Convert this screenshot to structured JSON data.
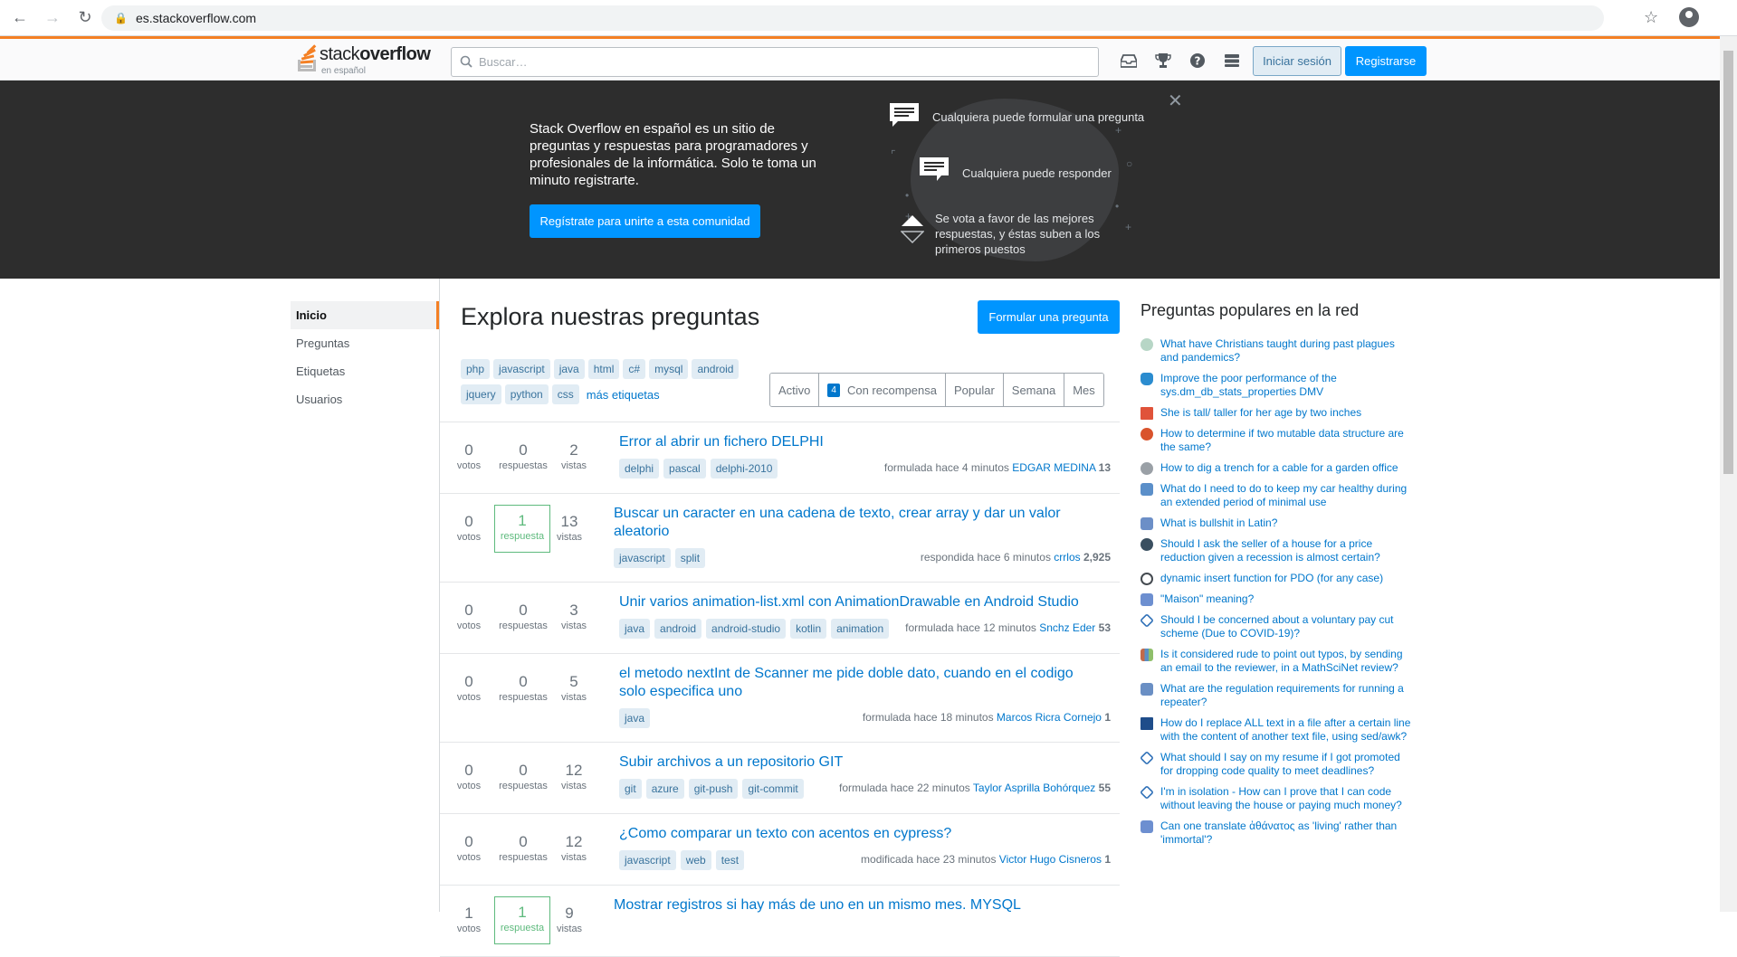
{
  "browser": {
    "url": "es.stackoverflow.com"
  },
  "topbar": {
    "logo_text_a": "stack",
    "logo_text_b": "overflow",
    "logo_sub": "en español",
    "search_placeholder": "Buscar…",
    "login_label": "Iniciar sesión",
    "signup_label": "Registrarse"
  },
  "hero": {
    "text": "Stack Overflow en español es un sitio de preguntas y respuestas para programadores y profesionales de la informática. Solo te toma un minuto registrarte.",
    "button": "Regístrate para unirte a esta comunidad",
    "features": [
      "Cualquiera puede formular una pregunta",
      "Cualquiera puede responder",
      "Se vota a favor de las mejores respuestas, y éstas suben a los primeros puestos"
    ]
  },
  "leftnav": {
    "items": [
      "Inicio",
      "Preguntas",
      "Etiquetas",
      "Usuarios"
    ]
  },
  "main": {
    "title": "Explora nuestras preguntas",
    "ask_button": "Formular una pregunta",
    "tags": [
      "php",
      "javascript",
      "java",
      "html",
      "c#",
      "mysql",
      "android",
      "jquery",
      "python",
      "css"
    ],
    "more_tags": "más etiquetas",
    "filters": {
      "active": "Activo",
      "bounty_count": "4",
      "bounty": "Con recompensa",
      "popular": "Popular",
      "week": "Semana",
      "month": "Mes"
    }
  },
  "questions": [
    {
      "votes": "0",
      "votes_label": "votos",
      "answers": "0",
      "answers_label": "respuestas",
      "views": "2",
      "views_label": "vistas",
      "title": "Error al abrir un fichero DELPHI",
      "tags": [
        "delphi",
        "pascal",
        "delphi-2010"
      ],
      "meta": "formulada hace 4 minutos",
      "user": "EDGAR MEDINA",
      "rep": "13"
    },
    {
      "votes": "0",
      "votes_label": "votos",
      "answers": "1",
      "answers_label": "respuesta",
      "views": "13",
      "views_label": "vistas",
      "title": "Buscar un caracter en una cadena de texto, crear array y dar un valor aleatorio",
      "tags": [
        "javascript",
        "split"
      ],
      "meta": "respondida hace 6 minutos",
      "user": "crrlos",
      "rep": "2,925"
    },
    {
      "votes": "0",
      "votes_label": "votos",
      "answers": "0",
      "answers_label": "respuestas",
      "views": "3",
      "views_label": "vistas",
      "title": "Unir varios animation-list.xml con AnimationDrawable en Android Studio",
      "tags": [
        "java",
        "android",
        "android-studio",
        "kotlin",
        "animation"
      ],
      "meta": "formulada hace 12 minutos",
      "user": "Snchz Eder",
      "rep": "53"
    },
    {
      "votes": "0",
      "votes_label": "votos",
      "answers": "0",
      "answers_label": "respuestas",
      "views": "5",
      "views_label": "vistas",
      "title": "el metodo nextInt de Scanner me pide doble dato, cuando en el codigo solo especifica uno",
      "tags": [
        "java"
      ],
      "meta": "formulada hace 18 minutos",
      "user": "Marcos Ricra Cornejo",
      "rep": "1"
    },
    {
      "votes": "0",
      "votes_label": "votos",
      "answers": "0",
      "answers_label": "respuestas",
      "views": "12",
      "views_label": "vistas",
      "title": "Subir archivos a un repositorio GIT",
      "tags": [
        "git",
        "azure",
        "git-push",
        "git-commit"
      ],
      "meta": "formulada hace 22 minutos",
      "user": "Taylor Asprilla Bohórquez",
      "rep": "55"
    },
    {
      "votes": "0",
      "votes_label": "votos",
      "answers": "0",
      "answers_label": "respuestas",
      "views": "12",
      "views_label": "vistas",
      "title": "¿Como comparar un texto con acentos en cypress?",
      "tags": [
        "javascript",
        "web",
        "test"
      ],
      "meta": "modificada hace 23 minutos",
      "user": "Victor Hugo Cisneros",
      "rep": "1"
    },
    {
      "votes": "1",
      "votes_label": "votos",
      "answers": "1",
      "answers_label": "respuesta",
      "views": "9",
      "views_label": "vistas",
      "title": "Mostrar registros si hay más de uno en un mismo mes. MYSQL",
      "tags": [],
      "meta": "",
      "user": "",
      "rep": ""
    }
  ],
  "hnq": {
    "title": "Preguntas populares en la red",
    "items": [
      {
        "text": "What have Christians taught during past plagues and pandemics?",
        "color": "#b7d6c6"
      },
      {
        "text": "Improve the poor performance of the sys.dm_db_stats_properties DMV",
        "color": "#2b8ccf"
      },
      {
        "text": "She is tall/ taller for her age by two inches",
        "color": "#e0533a"
      },
      {
        "text": "How to determine if two mutable data structure are the same?",
        "color": "#d9532c"
      },
      {
        "text": "How to dig a trench for a cable for a garden office",
        "color": "#9aa0a6"
      },
      {
        "text": "What do I need to do to keep my car healthy during an extended period of minimal use",
        "color": "#5b8fc9"
      },
      {
        "text": "What is bullshit in Latin?",
        "color": "#6c8fc7"
      },
      {
        "text": "Should I ask the seller of a house for a price reduction given a recession is almost certain?",
        "color": "#3a4f60"
      },
      {
        "text": "dynamic insert function for PDO (for any case)",
        "color": "#444a50"
      },
      {
        "text": "\"Maison\" meaning?",
        "color": "#6d8fd0"
      },
      {
        "text": "Should I be concerned about a voluntary pay cut scheme (Due to COVID-19)?",
        "color": "#2d6fb7"
      },
      {
        "text": "Is it considered rude to point out typos, by sending an email to the reviewer, in a MathSciNet review?",
        "color": "#c26a4a"
      },
      {
        "text": "What are the regulation requirements for running a repeater?",
        "color": "#6a8fc4"
      },
      {
        "text": "How do I replace ALL text in a file after a certain line with the content of another text file, using sed/awk?",
        "color": "#1f4d8a"
      },
      {
        "text": "What should I say on my resume if I got promoted for dropping code quality to meet deadlines?",
        "color": "#2d6fb7"
      },
      {
        "text": "I'm in isolation - How can I prove that I can code without leaving the house or paying much money?",
        "color": "#2d6fb7"
      },
      {
        "text": "Can one translate ἀθάνατος as 'living' rather than 'immortal'?",
        "color": "#6d8fd0"
      }
    ]
  }
}
